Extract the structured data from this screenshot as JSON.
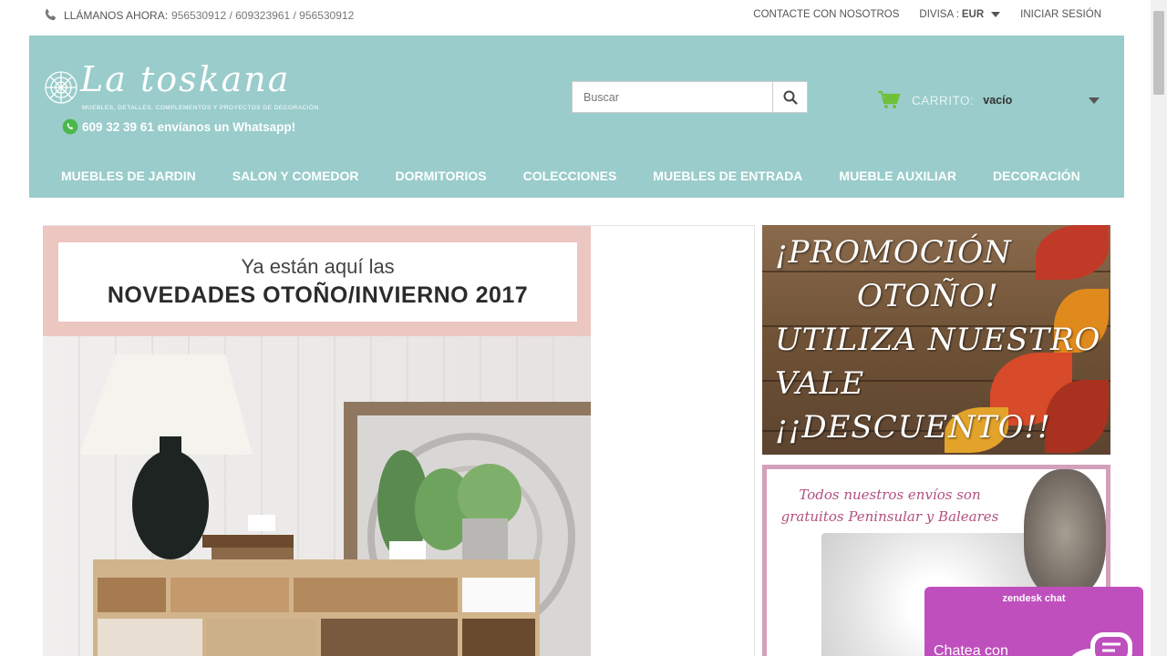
{
  "topbar": {
    "call_label": "LLÁMANOS AHORA:",
    "phone_numbers": "956530912 / 609323961 / 956530912",
    "contact_label": "CONTACTE CON NOSOTROS",
    "currency_label": "DIVISA :",
    "currency_value": "EUR",
    "login_label": "INICIAR SESIÓN"
  },
  "header": {
    "brand": "La toskana",
    "tagline": "MUEBLES, DETALLES, COMPLEMENTOS Y PROYECTOS DE DECORACIÓN",
    "whatsapp_text": "609 32 39 61 envíanos un Whatsapp!",
    "search_placeholder": "Buscar",
    "cart_label": "CARRITO:",
    "cart_value": "vacío",
    "color_header": "#99cccb"
  },
  "nav": {
    "items": [
      "MUEBLES DE JARDIN",
      "SALON Y COMEDOR",
      "DORMITORIOS",
      "COLECCIONES",
      "MUEBLES DE ENTRADA",
      "MUEBLE AUXILIAR",
      "DECORACIÓN"
    ]
  },
  "hero": {
    "line1": "Ya están aquí las",
    "line2": "NOVEDADES OTOÑO/INVIERNO 2017"
  },
  "promo": {
    "lines": [
      "¡PROMOCIÓN",
      "OTOÑO!",
      "UTILIZA NUESTRO",
      "VALE",
      "¡¡DESCUENTO!!"
    ]
  },
  "shipping": {
    "line1": "Todos nuestros envíos son",
    "line2": "gratuitos Peninsular y Baleares"
  },
  "chat": {
    "title": "zendesk chat",
    "subtitle": "Chatea con"
  },
  "icons": {
    "phone": "phone-icon",
    "search": "search-icon",
    "cart": "cart-icon",
    "whatsapp": "whatsapp-icon",
    "chat": "chat-bubble-icon"
  }
}
